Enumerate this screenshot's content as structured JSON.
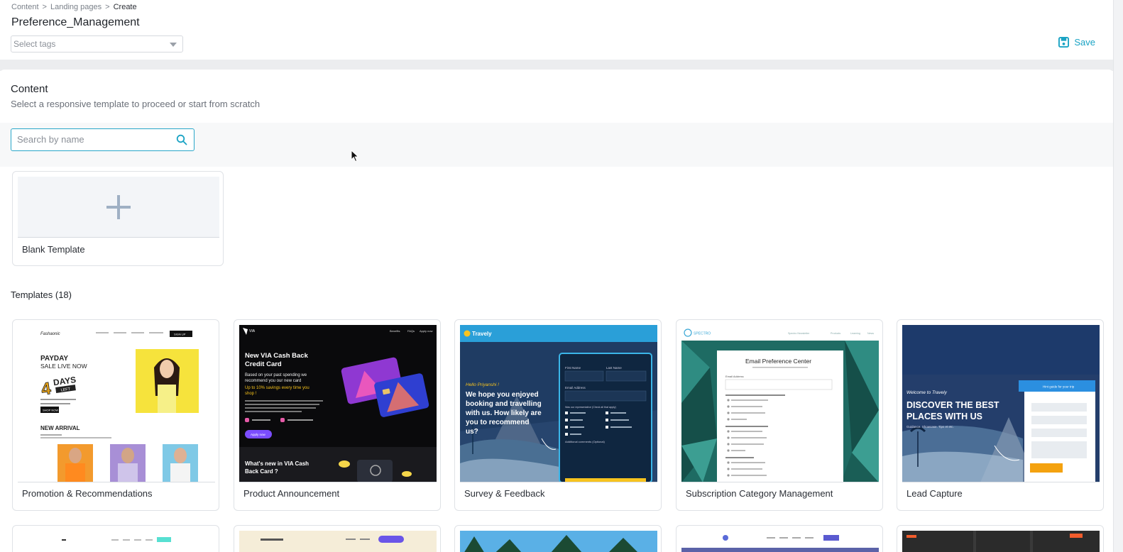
{
  "breadcrumb": {
    "items": [
      "Content",
      "Landing pages"
    ],
    "separator": ">",
    "current": "Create"
  },
  "page_title": "Preference_Management",
  "tags": {
    "placeholder": "Select tags"
  },
  "toolbar": {
    "save_label": "Save",
    "save_icon": "save-icon"
  },
  "content": {
    "title": "Content",
    "subtitle": "Select a responsive template to proceed or start from scratch"
  },
  "search": {
    "placeholder": "Search by name",
    "value": "",
    "icon": "search-icon"
  },
  "blank_template": {
    "label": "Blank Template",
    "icon": "plus-icon"
  },
  "templates": {
    "heading": "Templates (18)",
    "items": [
      {
        "label": "Promotion & Recommendations"
      },
      {
        "label": "Product Announcement"
      },
      {
        "label": "Survey & Feedback"
      },
      {
        "label": "Subscription Category Management"
      },
      {
        "label": "Lead Capture"
      }
    ]
  },
  "previews": {
    "promo": {
      "brand": "Fashaonic",
      "headline1": "PAYDAY",
      "headline2": "SALE LIVE NOW",
      "days_num": "4",
      "days_word": "DAYS",
      "days_left": "LEFT",
      "cta": "SHOP NOW",
      "section": "NEW ARRIVAL",
      "nav_cta": "SIGN UP"
    },
    "product": {
      "brand": "VIA",
      "title1": "New VIA Cash Back",
      "title2": "Credit Card",
      "line1": "Based on your past spending we",
      "line2": "recommend you our new card",
      "highlight1": "Up to 10% savings every time you",
      "highlight2": "shop !",
      "cta": "Apply now",
      "footer1": "What's new in VIA Cash",
      "footer2": "Back Card ?",
      "nav": [
        "Benefits",
        "FAQs",
        "Apply now"
      ]
    },
    "survey": {
      "brand": "Travely",
      "greeting": "Hello Priyanshi !",
      "q1": "We hope you enjoyed",
      "q2": "booking and travelling",
      "q3": "with us. How likely are",
      "q4": "you to recommend",
      "q5": "us?",
      "f_first": "First Name",
      "f_last": "Last Name",
      "f_email": "Email Address",
      "f_rep": "Was our representative (Check all that apply)",
      "f_comments": "Additional comments (Optional)"
    },
    "subscription": {
      "brand": "SPECTRO",
      "title": "Email Preference Center",
      "email_label": "Email Address",
      "nav": [
        "Spectro Newsletter",
        "Products",
        "Learning",
        "News"
      ]
    },
    "lead": {
      "welcome": "Welcome to Travely",
      "head1": "DISCOVER THE BEST",
      "head2": "PLACES WITH US",
      "sub": "Guidance. Showcase. Tips et etc.",
      "form_title": "Hint guide for your trip"
    }
  },
  "colors": {
    "accent": "#1aa3c4",
    "survey_accent": "#3bb5e8",
    "via_purple": "#7b4dff",
    "travely_yellow": "#f7c31e",
    "lead_blue": "#2b8fe0",
    "lead_orange": "#f4a20f"
  }
}
